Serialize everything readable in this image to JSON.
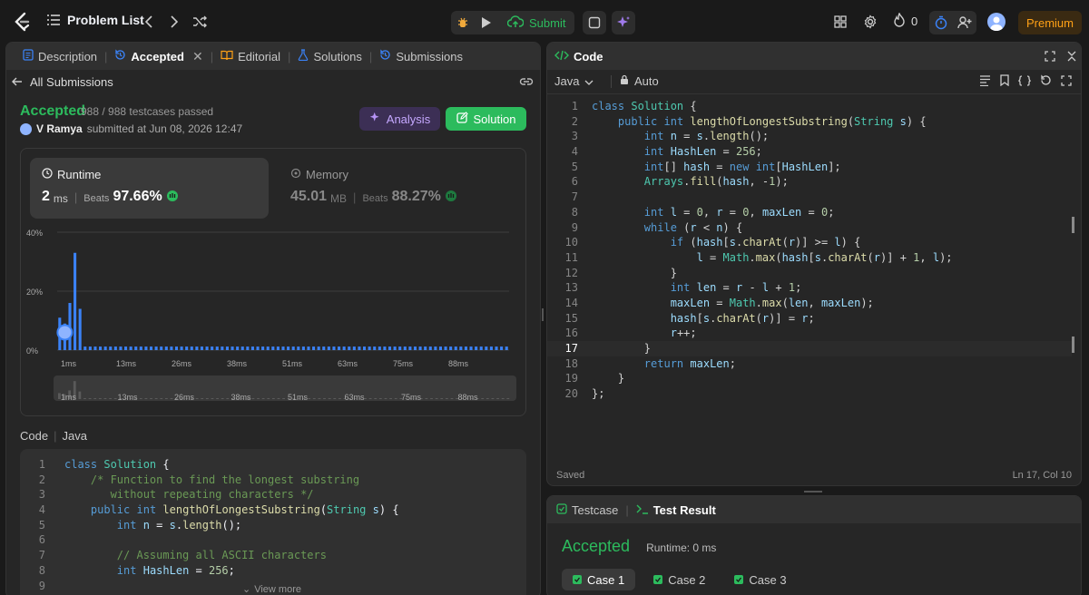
{
  "topbar": {
    "problem_list": "Problem List",
    "submit": "Submit",
    "streak_count": "0",
    "premium": "Premium"
  },
  "left_tabs": {
    "description": "Description",
    "accepted": "Accepted",
    "editorial": "Editorial",
    "solutions": "Solutions",
    "submissions": "Submissions"
  },
  "submission": {
    "back_label": "All Submissions",
    "status": "Accepted",
    "testcases": "988 / 988 testcases passed",
    "user": "V Ramya",
    "submitted_text": "submitted at Jun 08, 2026 12:47",
    "analysis_btn": "Analysis",
    "solution_btn": "Solution"
  },
  "runtime": {
    "label": "Runtime",
    "value": "2",
    "unit": "ms",
    "beats_label": "Beats",
    "beats": "97.66%"
  },
  "memory": {
    "label": "Memory",
    "value": "45.01",
    "unit": "MB",
    "beats_label": "Beats",
    "beats": "88.27%"
  },
  "chart_data": {
    "type": "bar",
    "ylabel_ticks": [
      "40%",
      "20%",
      "0%"
    ],
    "xticks": [
      "1ms",
      "13ms",
      "26ms",
      "38ms",
      "51ms",
      "63ms",
      "75ms",
      "88ms"
    ],
    "highlight_bin": "2ms",
    "values": [
      11,
      9,
      16,
      33,
      14,
      1.2,
      1.2,
      1.2,
      1.2,
      1.2,
      1.2,
      1.2,
      1.2,
      1.2,
      1.2,
      1.2,
      1.2,
      1.2,
      1.2,
      1.2,
      1.2,
      1.2,
      1.2,
      1.2,
      1.2,
      1.2,
      1.2,
      1.2,
      1.2,
      1.2,
      1.2,
      1.2,
      1.2,
      1.2,
      1.2,
      1.2,
      1.2,
      1.2,
      1.2,
      1.2,
      1.2,
      1.2,
      1.2,
      1.2,
      1.2,
      1.2,
      1.2,
      1.2,
      1.2,
      1.2,
      1.2,
      1.2,
      1.2,
      1.2,
      1.2,
      1.2,
      1.2,
      1.2,
      1.2,
      1.2,
      1.2,
      1.2,
      1.2,
      1.2,
      1.2,
      1.2,
      1.2,
      1.2,
      1.2,
      1.2,
      1.2,
      1.2,
      1.2,
      1.2,
      1.2,
      1.2,
      1.2,
      1.2,
      1.2,
      1.2,
      1.2,
      1.2,
      1.2,
      1.2,
      1.2,
      1.2,
      1.2,
      1.2,
      1.2
    ],
    "ylim": [
      0,
      40
    ],
    "colors": {
      "bar": "#3b82f6",
      "mini_bar": "#5a5a5a"
    }
  },
  "left_code": {
    "header_code": "Code",
    "header_lang": "Java",
    "view_more": "View more",
    "lines": [
      "class Solution {",
      "    /* Function to find the longest substring",
      "       without repeating characters */",
      "    public int lengthOfLongestSubstring(String s) {",
      "        int n = s.length();",
      "",
      "        // Assuming all ASCII characters",
      "        int HashLen = 256;"
    ]
  },
  "editor": {
    "title": "Code",
    "lang": "Java",
    "mode": "Auto",
    "saved": "Saved",
    "cursor": "Ln 17, Col 10",
    "lines": [
      "class Solution {",
      "    public int lengthOfLongestSubstring(String s) {",
      "        int n = s.length();",
      "        int HashLen = 256;",
      "        int[] hash = new int[HashLen];",
      "        Arrays.fill(hash, -1);",
      "",
      "        int l = 0, r = 0, maxLen = 0;",
      "        while (r < n) {",
      "            if (hash[s.charAt(r)] >= l) {",
      "                l = Math.max(hash[s.charAt(r)] + 1, l);",
      "            }",
      "            int len = r - l + 1;",
      "            maxLen = Math.max(len, maxLen);",
      "            hash[s.charAt(r)] = r;",
      "            r++;",
      "        }",
      "        return maxLen;",
      "    }",
      "};"
    ]
  },
  "testpanel": {
    "testcase_tab": "Testcase",
    "result_tab": "Test Result",
    "status": "Accepted",
    "runtime": "Runtime: 0 ms",
    "cases": [
      "Case 1",
      "Case 2",
      "Case 3"
    ]
  }
}
